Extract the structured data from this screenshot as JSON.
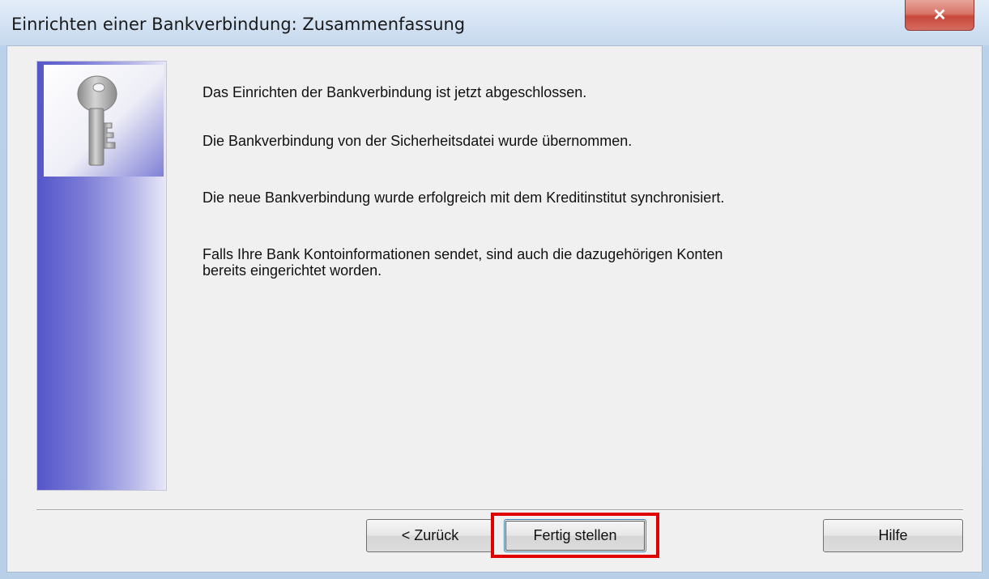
{
  "window": {
    "title": "Einrichten einer Bankverbindung: Zusammenfassung",
    "close_glyph": "✕"
  },
  "icons": {
    "wizard_image": "key-icon"
  },
  "content": {
    "line1": "Das Einrichten der Bankverbindung ist jetzt abgeschlossen.",
    "line2": "Die Bankverbindung von der Sicherheitsdatei wurde übernommen.",
    "line3": "Die neue Bankverbindung wurde erfolgreich mit dem Kreditinstitut synchronisiert.",
    "line4a": "Falls Ihre Bank Kontoinformationen sendet, sind auch die dazugehörigen Konten",
    "line4b": "bereits eingerichtet worden."
  },
  "buttons": {
    "back": "< Zurück",
    "finish": "Fertig stellen",
    "help": "Hilfe"
  },
  "colors": {
    "highlight": "#e00000",
    "panel_gradient_start": "#5456c9"
  }
}
